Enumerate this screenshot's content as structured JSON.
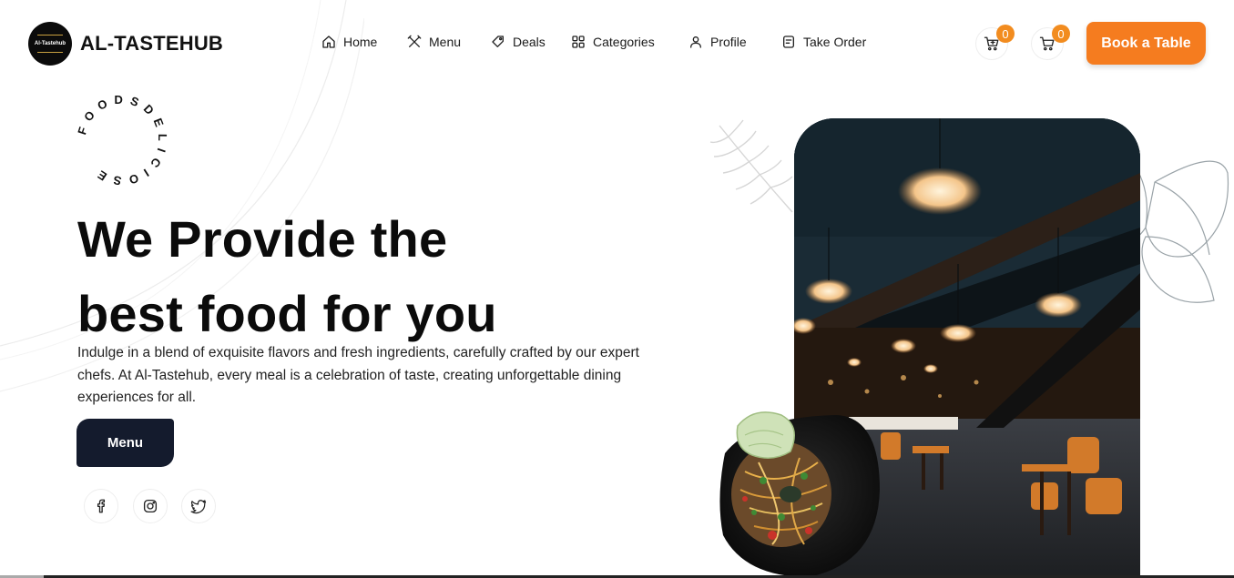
{
  "brand": {
    "logo_text": "Al-Tastehub",
    "name": "AL-TASTEHUB"
  },
  "nav": {
    "items": [
      {
        "label": "Home",
        "icon": "home-icon"
      },
      {
        "label": "Menu",
        "icon": "utensils-icon"
      },
      {
        "label": "Deals",
        "icon": "tag-icon"
      },
      {
        "label": "Categories",
        "icon": "grid-icon"
      },
      {
        "label": "Profile",
        "icon": "user-icon"
      },
      {
        "label": "Take Order",
        "icon": "order-icon"
      }
    ]
  },
  "carts": [
    {
      "icon": "cart-icon",
      "count": "0"
    },
    {
      "icon": "cart-icon",
      "count": "0"
    }
  ],
  "header": {
    "book_label": "Book a Table"
  },
  "hero": {
    "circle_text": "FOODSDELICIOSE",
    "title_line1": "We Provide the",
    "title_line2": "best food for you",
    "description": "Indulge in a blend of exquisite flavors and fresh ingredients, carefully crafted by our expert chefs. At Al-Tastehub, every meal is a celebration of taste, creating unforgettable dining experiences for all.",
    "menu_button": "Menu"
  },
  "social": [
    "facebook-icon",
    "instagram-icon",
    "twitter-icon"
  ],
  "colors": {
    "accent": "#f57c1f",
    "badge": "#f28c1f",
    "dark_button": "#141b2d",
    "text": "#0b0b0b"
  }
}
